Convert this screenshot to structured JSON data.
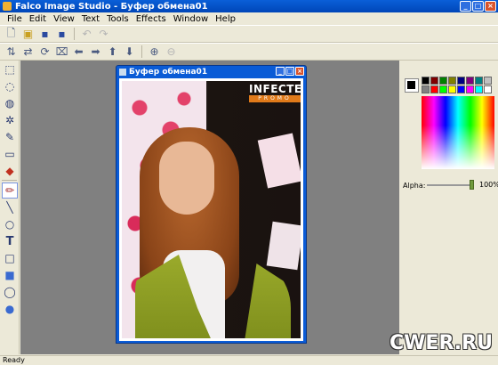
{
  "window": {
    "title": "Falco Image Studio - Буфер обмена01"
  },
  "menu": [
    "File",
    "Edit",
    "View",
    "Text",
    "Tools",
    "Effects",
    "Window",
    "Help"
  ],
  "toolbar1": [
    "new-icon",
    "open-icon",
    "save-icon",
    "save-as-icon",
    "undo-icon",
    "redo-icon"
  ],
  "toolbar2": [
    "flip-vertical-icon",
    "flip-horizontal-icon",
    "rotate-icon",
    "crop-icon",
    "arrow-left-icon",
    "arrow-right-icon",
    "arrow-up-icon",
    "arrow-down-icon",
    "zoom-in-icon",
    "zoom-out-icon"
  ],
  "tools": [
    "rect-select-icon",
    "ellipse-select-icon",
    "lasso-icon",
    "magic-wand-icon",
    "eyedropper-icon",
    "eraser-icon",
    "fill-icon",
    "pencil-icon",
    "line-icon",
    "circle-icon",
    "text-icon",
    "rectangle-icon",
    "filled-rectangle-icon",
    "ellipse-icon",
    "filled-ellipse-icon"
  ],
  "child_window": {
    "title": "Буфер обмена01"
  },
  "photo_logo": {
    "line1": "INFECTED",
    "line2": "PROMO"
  },
  "palette_colors": [
    "#000000",
    "#800000",
    "#008000",
    "#808000",
    "#000080",
    "#800080",
    "#008080",
    "#c0c0c0",
    "#808080",
    "#ff0000",
    "#00ff00",
    "#ffff00",
    "#0000ff",
    "#ff00ff",
    "#00ffff",
    "#ffffff"
  ],
  "color_panel": {
    "alpha_label": "Alpha:",
    "alpha_value": "100%"
  },
  "status": {
    "text": "Ready"
  },
  "watermark": "CWER.RU"
}
